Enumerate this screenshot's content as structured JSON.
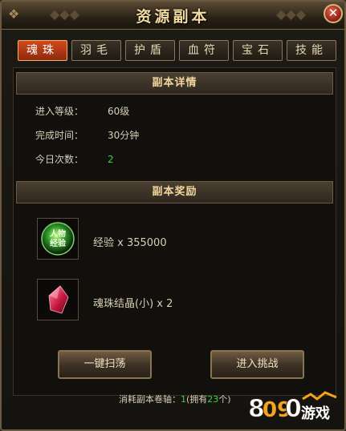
{
  "window": {
    "title": "资源副本",
    "close_glyph": "✕"
  },
  "tabs": [
    {
      "label": "魂珠",
      "active": true
    },
    {
      "label": "羽毛",
      "active": false
    },
    {
      "label": "护盾",
      "active": false
    },
    {
      "label": "血符",
      "active": false
    },
    {
      "label": "宝石",
      "active": false
    },
    {
      "label": "技能",
      "active": false
    }
  ],
  "details": {
    "header": "副本详情",
    "level_label": "进入等级：",
    "level_value": "60级",
    "time_label": "完成时间：",
    "time_value": "30分钟",
    "count_label": "今日次数：",
    "count_value": "2"
  },
  "rewards": {
    "header": "副本奖励",
    "items": [
      {
        "icon": "exp-orb-icon",
        "icon_text": "人物经验",
        "text": "经验 x 355000"
      },
      {
        "icon": "red-crystal-icon",
        "text": "魂珠结晶(小) x 2"
      }
    ]
  },
  "buttons": {
    "sweep": "一键扫荡",
    "challenge": "进入挑战"
  },
  "footer": {
    "prefix": "消耗副本卷轴：",
    "cost": "1",
    "owned_prefix": "(拥有",
    "owned": "23",
    "owned_suffix": "个)"
  },
  "watermark": {
    "text": "8090游戏"
  },
  "colors": {
    "accent_green": "#3fd23f",
    "active_tab": "#d24a1e",
    "gold_text": "#f4dca0"
  }
}
